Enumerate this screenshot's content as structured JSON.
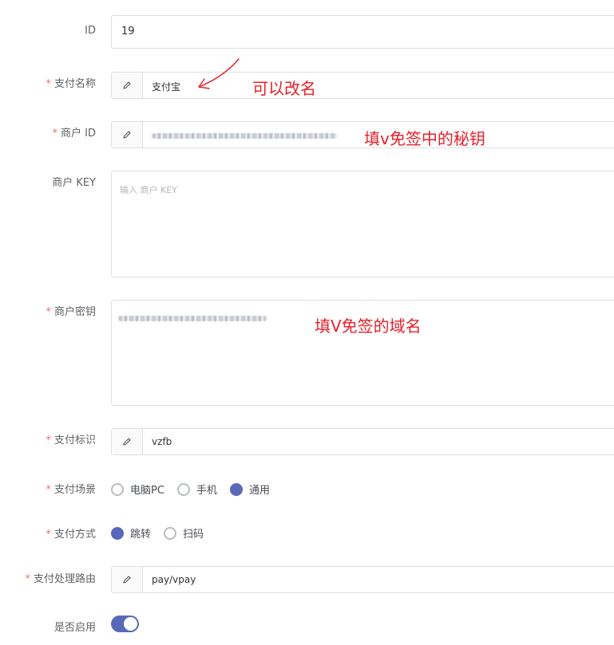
{
  "form": {
    "id": {
      "label": "ID",
      "value": "19"
    },
    "pay_name": {
      "label": "支付名称",
      "value": "支付宝"
    },
    "merchant_id": {
      "label": "商户 ID"
    },
    "merchant_key": {
      "label": "商户 KEY",
      "placeholder": "输入 商户 KEY"
    },
    "merchant_secret": {
      "label": "商户密钥"
    },
    "pay_code": {
      "label": "支付标识",
      "value": "vzfb"
    },
    "pay_scene": {
      "label": "支付场景",
      "options": [
        "电脑PC",
        "手机",
        "通用"
      ],
      "selected": "通用"
    },
    "pay_method": {
      "label": "支付方式",
      "options": [
        "跳转",
        "扫码"
      ],
      "selected": "跳转"
    },
    "pay_route": {
      "label": "支付处理路由",
      "value": "pay/vpay"
    },
    "enabled": {
      "label": "是否启用",
      "value": true
    }
  },
  "annotations": {
    "rename": "可以改名",
    "secret": "填v免签中的秘钥",
    "domain": "填V免签的域名"
  },
  "required_mark": "*",
  "icons": {
    "prefix": "pencil-icon"
  },
  "colors": {
    "accent": "#5a68ba",
    "required": "#f56c6c",
    "annotation": "#e8202a"
  }
}
